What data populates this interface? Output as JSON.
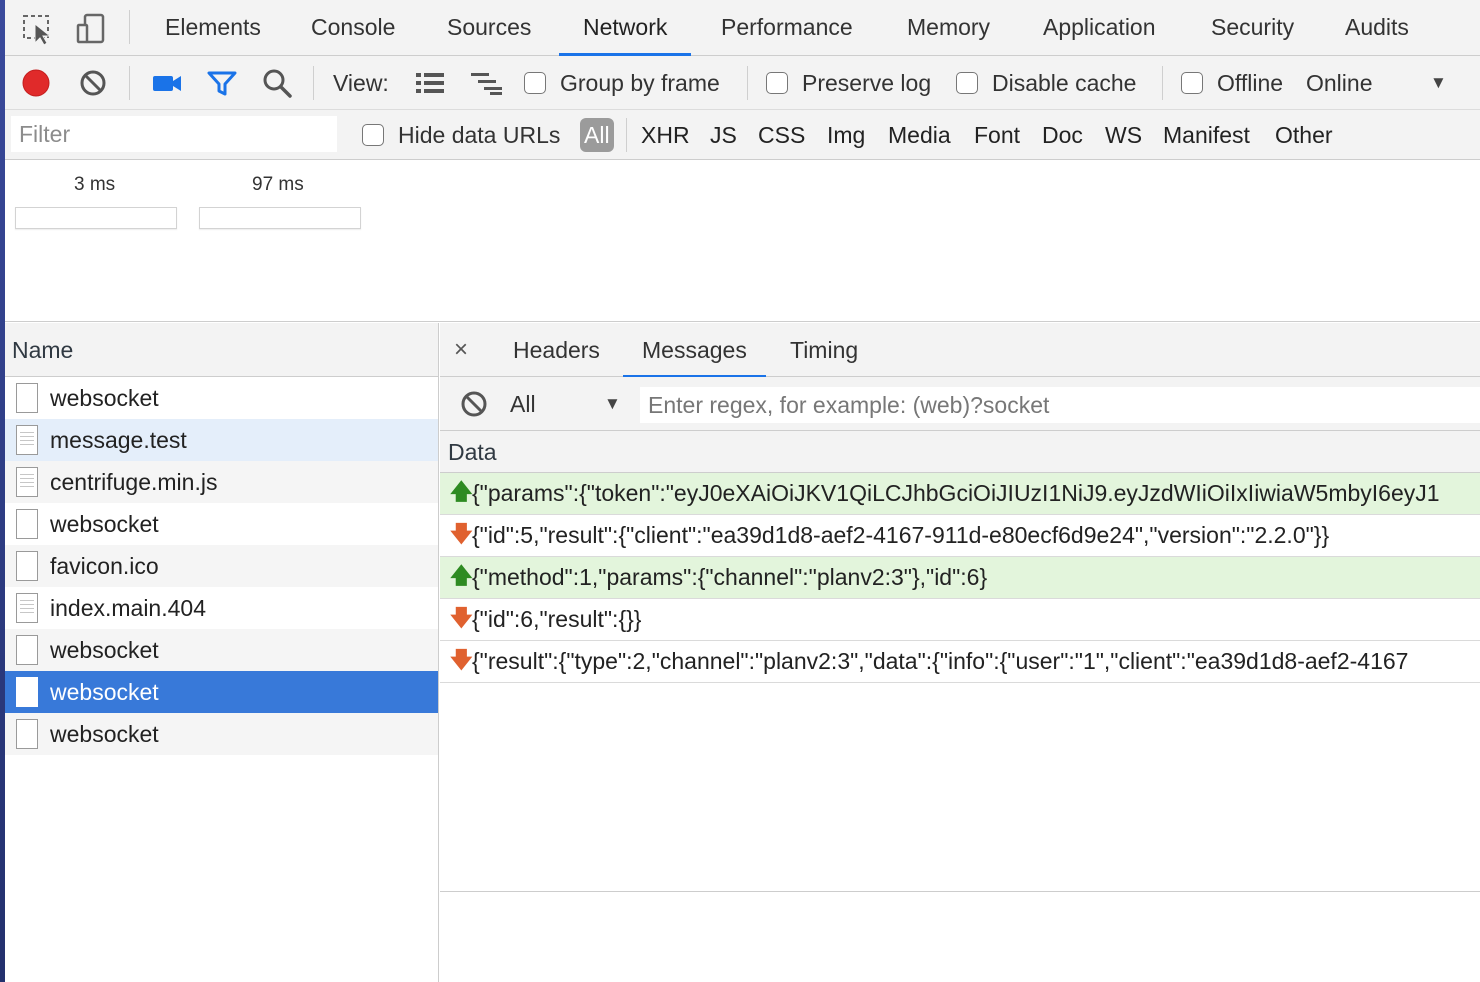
{
  "main_tabs": [
    {
      "label": "Elements"
    },
    {
      "label": "Console"
    },
    {
      "label": "Sources"
    },
    {
      "label": "Network"
    },
    {
      "label": "Performance"
    },
    {
      "label": "Memory"
    },
    {
      "label": "Application"
    },
    {
      "label": "Security"
    },
    {
      "label": "Audits"
    }
  ],
  "active_tab": "Network",
  "toolbar": {
    "view_label": "View:",
    "group_by_frame": "Group by frame",
    "preserve_log": "Preserve log",
    "disable_cache": "Disable cache",
    "offline": "Offline",
    "throttling": "Online"
  },
  "filterbar": {
    "filter_placeholder": "Filter",
    "hide_data_urls": "Hide data URLs",
    "types": [
      "All",
      "XHR",
      "JS",
      "CSS",
      "Img",
      "Media",
      "Font",
      "Doc",
      "WS",
      "Manifest",
      "Other"
    ]
  },
  "overview": {
    "labels": [
      "3 ms",
      "97 ms"
    ]
  },
  "requests": {
    "column_header": "Name",
    "rows": [
      {
        "name": "websocket",
        "icon": "document-icon"
      },
      {
        "name": "message.test",
        "icon": "script-icon"
      },
      {
        "name": "centrifuge.min.js",
        "icon": "script-icon"
      },
      {
        "name": "websocket",
        "icon": "document-icon"
      },
      {
        "name": "favicon.ico",
        "icon": "document-icon"
      },
      {
        "name": "index.main.404",
        "icon": "script-icon"
      },
      {
        "name": "websocket",
        "icon": "document-icon"
      },
      {
        "name": "websocket",
        "icon": "document-icon"
      },
      {
        "name": "websocket",
        "icon": "document-icon"
      }
    ],
    "selected_index": 7,
    "hover_index": 1
  },
  "detail": {
    "close_symbol": "×",
    "tabs": [
      "Headers",
      "Messages",
      "Timing"
    ],
    "active_tab": "Messages",
    "message_filter": {
      "selected": "All",
      "regex_placeholder": "Enter regex, for example: (web)?socket"
    },
    "data_header": "Data",
    "messages": [
      {
        "direction": "sent",
        "text": "{\"params\":{\"token\":\"eyJ0eXAiOiJKV1QiLCJhbGciOiJIUzI1NiJ9.eyJzdWIiOiIxIiwiaW5mbyI6eyJ1"
      },
      {
        "direction": "received",
        "text": "{\"id\":5,\"result\":{\"client\":\"ea39d1d8-aef2-4167-911d-e80ecf6d9e24\",\"version\":\"2.2.0\"}}"
      },
      {
        "direction": "sent",
        "text": "{\"method\":1,\"params\":{\"channel\":\"planv2:3\"},\"id\":6}"
      },
      {
        "direction": "received",
        "text": "{\"id\":6,\"result\":{}}"
      },
      {
        "direction": "received",
        "text": "{\"result\":{\"type\":2,\"channel\":\"planv2:3\",\"data\":{\"info\":{\"user\":\"1\",\"client\":\"ea39d1d8-aef2-4167"
      }
    ]
  },
  "colors": {
    "accent": "#1a73e8",
    "record": "#e02a2a",
    "selected_row": "#3879d9",
    "sent_message_bg": "#e3f5dc",
    "sent_arrow": "#2e8b22",
    "received_arrow": "#e0612f"
  }
}
